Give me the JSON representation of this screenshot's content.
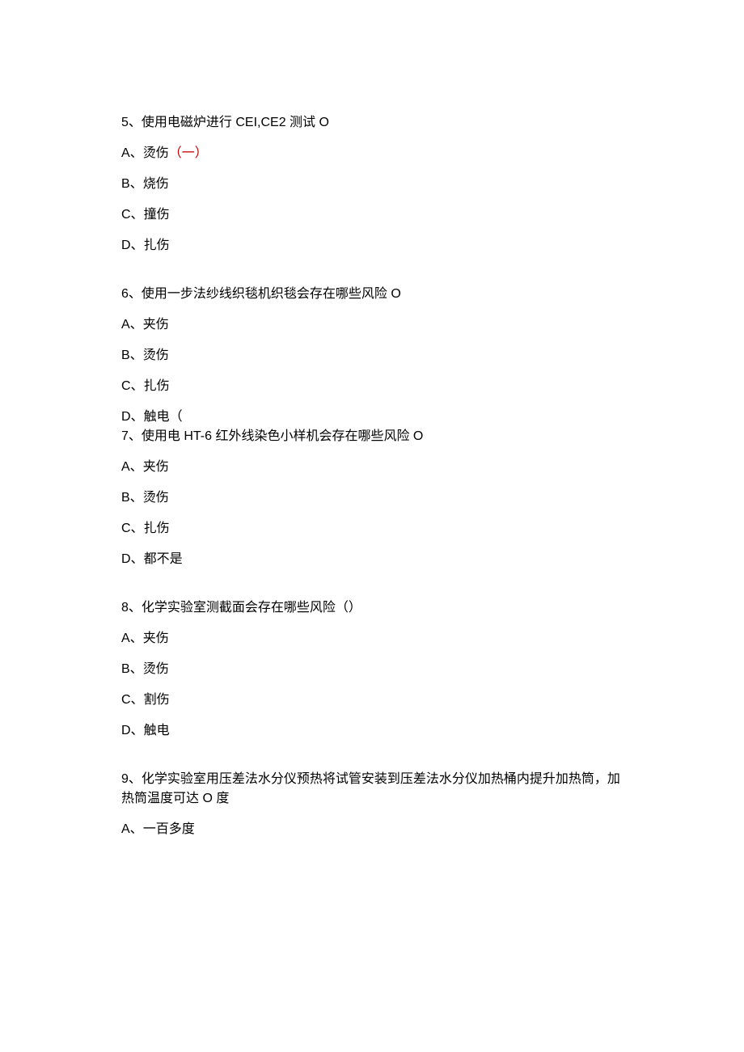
{
  "questions": [
    {
      "number": "5、",
      "text": "使用电磁炉进行 CEI,CE2 测试 О",
      "options": [
        {
          "label": "A、",
          "text": "烫伤",
          "mark": "（一）"
        },
        {
          "label": "B、",
          "text": "烧伤",
          "mark": ""
        },
        {
          "label": "C、",
          "text": "撞伤",
          "mark": ""
        },
        {
          "label": "D、",
          "text": "扎伤",
          "mark": ""
        }
      ]
    },
    {
      "number": "6、",
      "text": "使用一步法纱线织毯机织毯会存在哪些风险 О",
      "options": [
        {
          "label": "A、",
          "text": "夹伤",
          "mark": ""
        },
        {
          "label": "B、",
          "text": "烫伤",
          "mark": ""
        },
        {
          "label": "C、",
          "text": "扎伤",
          "mark": ""
        },
        {
          "label": "D、",
          "text": "触电（",
          "mark": ""
        }
      ]
    },
    {
      "number": "7、",
      "text": "使用电 HT-6 红外线染色小样机会存在哪些风险 О",
      "options": [
        {
          "label": "A、",
          "text": "夹伤",
          "mark": ""
        },
        {
          "label": "B、",
          "text": "烫伤",
          "mark": ""
        },
        {
          "label": "C、",
          "text": "扎伤",
          "mark": ""
        },
        {
          "label": "D、",
          "text": "都不是",
          "mark": ""
        }
      ]
    },
    {
      "number": "8、",
      "text": "化学实验室测截面会存在哪些风险（）",
      "options": [
        {
          "label": "A、",
          "text": "夹伤",
          "mark": ""
        },
        {
          "label": "B、",
          "text": "烫伤",
          "mark": ""
        },
        {
          "label": "C、",
          "text": "割伤",
          "mark": ""
        },
        {
          "label": "D、",
          "text": "触电",
          "mark": ""
        }
      ]
    },
    {
      "number": "9、",
      "text": "化学实验室用压差法水分仪预热将试管安装到压差法水分仪加热桶内提升加热筒，加热筒温度可达 О 度",
      "options": [
        {
          "label": "A、",
          "text": "一百多度",
          "mark": ""
        }
      ]
    }
  ]
}
